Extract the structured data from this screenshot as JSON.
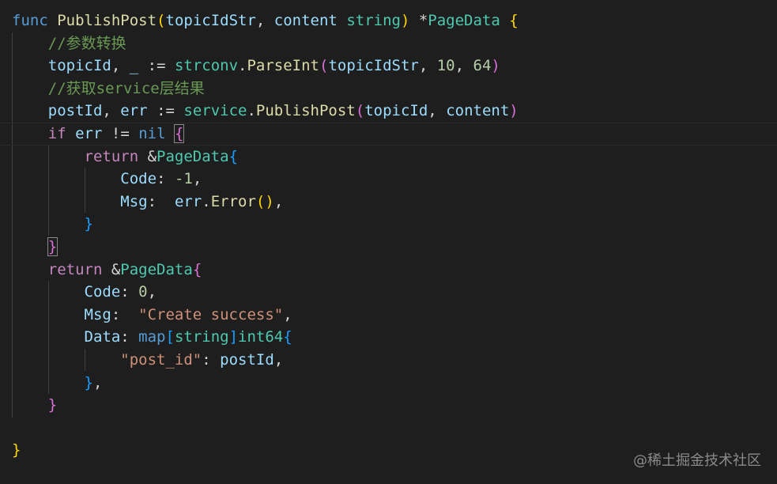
{
  "code_lines": [
    [
      {
        "t": "func ",
        "c": "kw"
      },
      {
        "t": "PublishPost",
        "c": "fn"
      },
      {
        "t": "(",
        "c": "b1"
      },
      {
        "t": "topicIdStr",
        "c": "var"
      },
      {
        "t": ", ",
        "c": "op"
      },
      {
        "t": "content",
        "c": "var"
      },
      {
        "t": " ",
        "c": "op"
      },
      {
        "t": "string",
        "c": "type"
      },
      {
        "t": ") ",
        "c": "b1"
      },
      {
        "t": "*",
        "c": "op"
      },
      {
        "t": "PageData",
        "c": "type"
      },
      {
        "t": " {",
        "c": "b1"
      }
    ],
    [
      {
        "t": "    //参数转换",
        "c": "cmt"
      }
    ],
    [
      {
        "t": "    ",
        "c": "op"
      },
      {
        "t": "topicId",
        "c": "var"
      },
      {
        "t": ", ",
        "c": "op"
      },
      {
        "t": "_",
        "c": "var"
      },
      {
        "t": " := ",
        "c": "op"
      },
      {
        "t": "strconv",
        "c": "type"
      },
      {
        "t": ".",
        "c": "op"
      },
      {
        "t": "ParseInt",
        "c": "fn"
      },
      {
        "t": "(",
        "c": "b2"
      },
      {
        "t": "topicIdStr",
        "c": "var"
      },
      {
        "t": ", ",
        "c": "op"
      },
      {
        "t": "10",
        "c": "num"
      },
      {
        "t": ", ",
        "c": "op"
      },
      {
        "t": "64",
        "c": "num"
      },
      {
        "t": ")",
        "c": "b2"
      }
    ],
    [
      {
        "t": "    //获取service层结果",
        "c": "cmt"
      }
    ],
    [
      {
        "t": "    ",
        "c": "op"
      },
      {
        "t": "postId",
        "c": "var"
      },
      {
        "t": ", ",
        "c": "op"
      },
      {
        "t": "err",
        "c": "var"
      },
      {
        "t": " := ",
        "c": "op"
      },
      {
        "t": "service",
        "c": "type"
      },
      {
        "t": ".",
        "c": "op"
      },
      {
        "t": "PublishPost",
        "c": "fn"
      },
      {
        "t": "(",
        "c": "b2"
      },
      {
        "t": "topicId",
        "c": "var"
      },
      {
        "t": ", ",
        "c": "op"
      },
      {
        "t": "content",
        "c": "var"
      },
      {
        "t": ")",
        "c": "b2"
      }
    ],
    [
      {
        "t": "    ",
        "c": "op"
      },
      {
        "t": "if",
        "c": "ctrl"
      },
      {
        "t": " ",
        "c": "op"
      },
      {
        "t": "err",
        "c": "var"
      },
      {
        "t": " != ",
        "c": "op"
      },
      {
        "t": "nil",
        "c": "kw"
      },
      {
        "t": " ",
        "c": "op"
      },
      {
        "t": "{",
        "c": "b2 bracket-match"
      }
    ],
    [
      {
        "t": "        ",
        "c": "op"
      },
      {
        "t": "return",
        "c": "ctrl"
      },
      {
        "t": " &",
        "c": "op"
      },
      {
        "t": "PageData",
        "c": "type"
      },
      {
        "t": "{",
        "c": "b3"
      }
    ],
    [
      {
        "t": "            ",
        "c": "op"
      },
      {
        "t": "Code",
        "c": "var"
      },
      {
        "t": ": ",
        "c": "op"
      },
      {
        "t": "-1",
        "c": "num"
      },
      {
        "t": ",",
        "c": "op"
      }
    ],
    [
      {
        "t": "            ",
        "c": "op"
      },
      {
        "t": "Msg",
        "c": "var"
      },
      {
        "t": ":  ",
        "c": "op"
      },
      {
        "t": "err",
        "c": "var"
      },
      {
        "t": ".",
        "c": "op"
      },
      {
        "t": "Error",
        "c": "fn"
      },
      {
        "t": "()",
        "c": "b1"
      },
      {
        "t": ",",
        "c": "op"
      }
    ],
    [
      {
        "t": "        ",
        "c": "op"
      },
      {
        "t": "}",
        "c": "b3"
      }
    ],
    [
      {
        "t": "    ",
        "c": "op"
      },
      {
        "t": "}",
        "c": "b2 bracket-match"
      }
    ],
    [
      {
        "t": "    ",
        "c": "op"
      },
      {
        "t": "return",
        "c": "ctrl"
      },
      {
        "t": " &",
        "c": "op"
      },
      {
        "t": "PageData",
        "c": "type"
      },
      {
        "t": "{",
        "c": "b2"
      }
    ],
    [
      {
        "t": "        ",
        "c": "op"
      },
      {
        "t": "Code",
        "c": "var"
      },
      {
        "t": ": ",
        "c": "op"
      },
      {
        "t": "0",
        "c": "num"
      },
      {
        "t": ",",
        "c": "op"
      }
    ],
    [
      {
        "t": "        ",
        "c": "op"
      },
      {
        "t": "Msg",
        "c": "var"
      },
      {
        "t": ":  ",
        "c": "op"
      },
      {
        "t": "\"Create success\"",
        "c": "str"
      },
      {
        "t": ",",
        "c": "op"
      }
    ],
    [
      {
        "t": "        ",
        "c": "op"
      },
      {
        "t": "Data",
        "c": "var"
      },
      {
        "t": ": ",
        "c": "op"
      },
      {
        "t": "map",
        "c": "kw"
      },
      {
        "t": "[",
        "c": "b3"
      },
      {
        "t": "string",
        "c": "type"
      },
      {
        "t": "]",
        "c": "b3"
      },
      {
        "t": "int64",
        "c": "type"
      },
      {
        "t": "{",
        "c": "b3"
      }
    ],
    [
      {
        "t": "            ",
        "c": "op"
      },
      {
        "t": "\"post_id\"",
        "c": "str"
      },
      {
        "t": ": ",
        "c": "op"
      },
      {
        "t": "postId",
        "c": "var"
      },
      {
        "t": ",",
        "c": "op"
      }
    ],
    [
      {
        "t": "        ",
        "c": "op"
      },
      {
        "t": "}",
        "c": "b3"
      },
      {
        "t": ",",
        "c": "op"
      }
    ],
    [
      {
        "t": "    ",
        "c": "op"
      },
      {
        "t": "}",
        "c": "b2"
      }
    ],
    [
      {
        "t": "",
        "c": "op"
      }
    ],
    [
      {
        "t": "}",
        "c": "b1"
      }
    ]
  ],
  "watermark": "@稀土掘金技术社区"
}
